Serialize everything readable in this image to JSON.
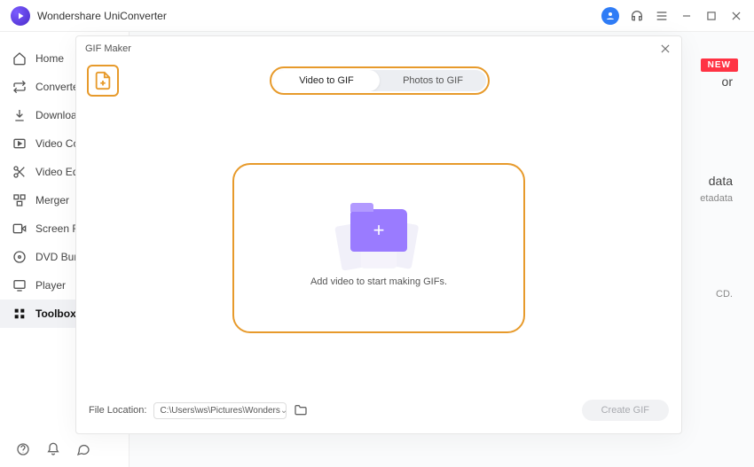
{
  "titlebar": {
    "title": "Wondershare UniConverter"
  },
  "sidebar": {
    "items": [
      {
        "label": "Home"
      },
      {
        "label": "Converter"
      },
      {
        "label": "Downloader"
      },
      {
        "label": "Video Compressor"
      },
      {
        "label": "Video Editor"
      },
      {
        "label": "Merger"
      },
      {
        "label": "Screen Recorder"
      },
      {
        "label": "DVD Burner"
      },
      {
        "label": "Player"
      },
      {
        "label": "Toolbox"
      }
    ]
  },
  "background": {
    "new": "NEW",
    "t1": "or",
    "t2": "data",
    "t3": "etadata",
    "t4": "CD."
  },
  "modal": {
    "title": "GIF Maker",
    "tabs": {
      "video": "Video to GIF",
      "photos": "Photos to GIF"
    },
    "drop_hint": "Add video to start making GIFs.",
    "file_location_label": "File Location:",
    "file_location_value": "C:\\Users\\ws\\Pictures\\Wonders",
    "create_btn": "Create GIF"
  }
}
